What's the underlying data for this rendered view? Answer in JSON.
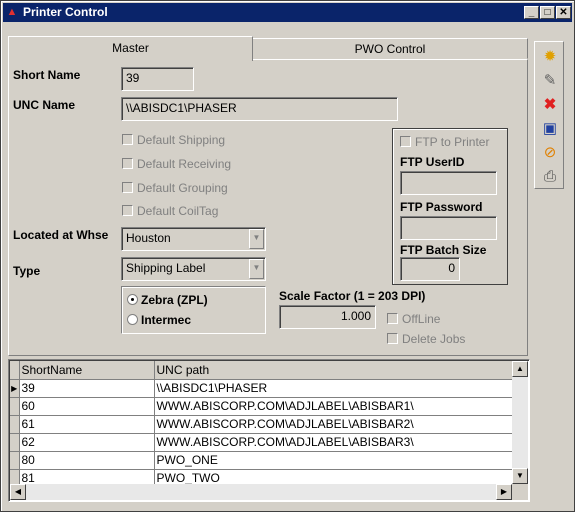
{
  "window": {
    "title": "Printer Control",
    "icon": "printer-app-icon",
    "controls": {
      "minimize": "_",
      "maximize": "□",
      "close": "✕"
    }
  },
  "tabs": [
    {
      "label": "Master",
      "active": true
    },
    {
      "label": "PWO Control",
      "active": false
    }
  ],
  "form": {
    "short_name_label": "Short Name",
    "short_name_value": "39",
    "unc_name_label": "UNC Name",
    "unc_name_value": "\\\\ABISDC1\\PHASER",
    "checkboxes": {
      "default_shipping": "Default Shipping",
      "default_receiving": "Default Receiving",
      "default_grouping": "Default Grouping",
      "default_coiltag": "Default CoilTag"
    },
    "located_label": "Located at Whse",
    "located_value": "Houston",
    "type_label": "Type",
    "type_value": "Shipping Label",
    "radio_zebra": "Zebra (ZPL)",
    "radio_intermec": "Intermec",
    "radio_selected": "Zebra (ZPL)",
    "scale_label": "Scale Factor (1 = 203 DPI)",
    "scale_value": "1.000",
    "offline_label": "OffLine",
    "delete_jobs_label": "Delete Jobs",
    "ftp": {
      "ftp_to_printer_label": "FTP to Printer",
      "userid_label": "FTP UserID",
      "userid_value": "",
      "password_label": "FTP Password",
      "password_value": "",
      "batch_size_label": "FTP Batch Size",
      "batch_size_value": "0"
    }
  },
  "toolbar": {
    "items": [
      "new-icon",
      "edit-icon",
      "delete-icon",
      "save-icon",
      "cancel-icon",
      "print-icon"
    ]
  },
  "grid": {
    "columns": [
      "ShortName",
      "UNC path"
    ],
    "rows": [
      {
        "short_name": "39",
        "unc_path": "\\\\ABISDC1\\PHASER",
        "current": true
      },
      {
        "short_name": "60",
        "unc_path": "WWW.ABISCORP.COM\\ADJLABEL\\ABISBAR1\\",
        "current": false
      },
      {
        "short_name": "61",
        "unc_path": "WWW.ABISCORP.COM\\ADJLABEL\\ABISBAR2\\",
        "current": false
      },
      {
        "short_name": "62",
        "unc_path": "WWW.ABISCORP.COM\\ADJLABEL\\ABISBAR3\\",
        "current": false
      },
      {
        "short_name": "80",
        "unc_path": "PWO_ONE",
        "current": false
      },
      {
        "short_name": "81",
        "unc_path": "PWO_TWO",
        "current": false
      }
    ]
  }
}
